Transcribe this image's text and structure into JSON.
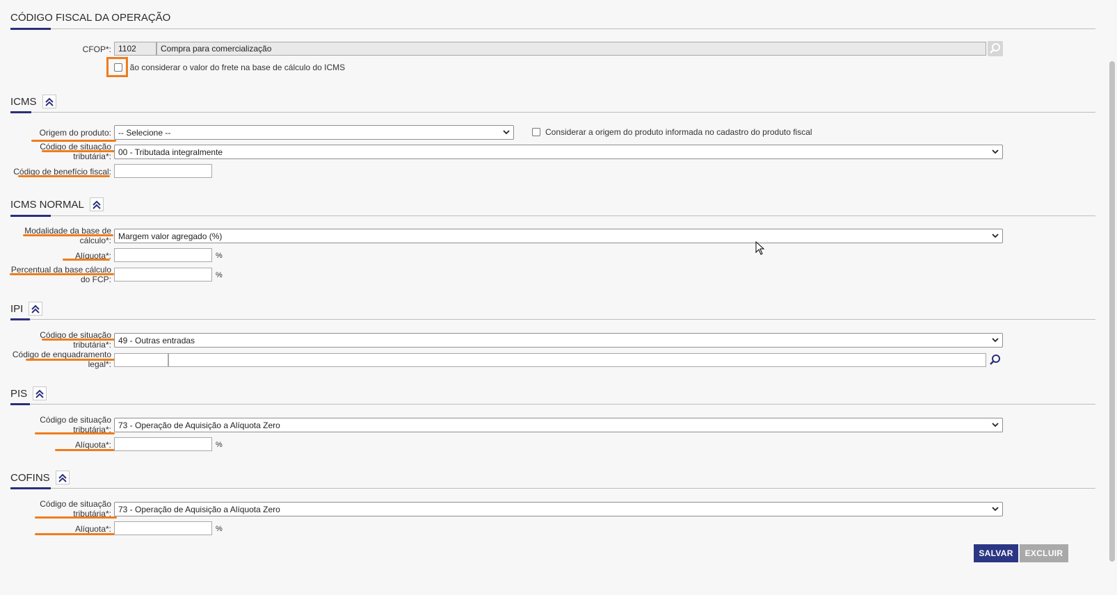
{
  "cfop_section": {
    "title": "CÓDIGO FISCAL DA OPERAÇÃO",
    "cfop_label": "CFOP*:",
    "cfop_code": "1102",
    "cfop_description": "Compra para comercialização",
    "freight_checkbox_label": "Não considerar o valor do frete na base de cálculo do ICMS"
  },
  "icms": {
    "title": "ICMS",
    "origin_label": "Origem do produto:",
    "origin_value": "-- Selecione --",
    "origin_checkbox_label": "Considerar a origem do produto informada no cadastro do produto fiscal",
    "cst_label_1": "Código de situação",
    "cst_label_2": "tributária*:",
    "cst_value": "00 - Tributada integralmente",
    "benefit_label": "Código de benefício fiscal:",
    "benefit_value": ""
  },
  "icms_normal": {
    "title": "ICMS NORMAL",
    "modality_label_1": "Modalidade da base de",
    "modality_label_2": "cálculo*:",
    "modality_value": "Margem valor agregado (%)",
    "rate_label": "Alíquota*:",
    "rate_value": "",
    "fcp_label_1": "Percentual da base cálculo",
    "fcp_label_2": "do FCP:",
    "fcp_value": "",
    "percent": "%"
  },
  "ipi": {
    "title": "IPI",
    "cst_label_1": "Código de situação",
    "cst_label_2": "tributária*:",
    "cst_value": "49 - Outras entradas",
    "enq_label_1": "Código de enquadramento",
    "enq_label_2": "legal*:",
    "enq_code": "",
    "enq_description": ""
  },
  "pis": {
    "title": "PIS",
    "cst_label_1": "Código de situação",
    "cst_label_2": "tributária*:",
    "cst_value": "73 - Operação de Aquisição a Alíquota Zero",
    "rate_label": "Alíquota*:",
    "rate_value": "",
    "percent": "%"
  },
  "cofins": {
    "title": "COFINS",
    "cst_label_1": "Código de situação",
    "cst_label_2": "tributária*:",
    "cst_value": "73 - Operação de Aquisição a Alíquota Zero",
    "rate_label": "Alíquota*:",
    "rate_value": "",
    "percent": "%"
  },
  "actions": {
    "save": "SALVAR",
    "delete": "EXCLUIR"
  },
  "colors": {
    "accent": "#2a2f7a",
    "annotation": "#f07c1c",
    "save_button": "#2b3784",
    "delete_button": "#a9a9a9"
  }
}
